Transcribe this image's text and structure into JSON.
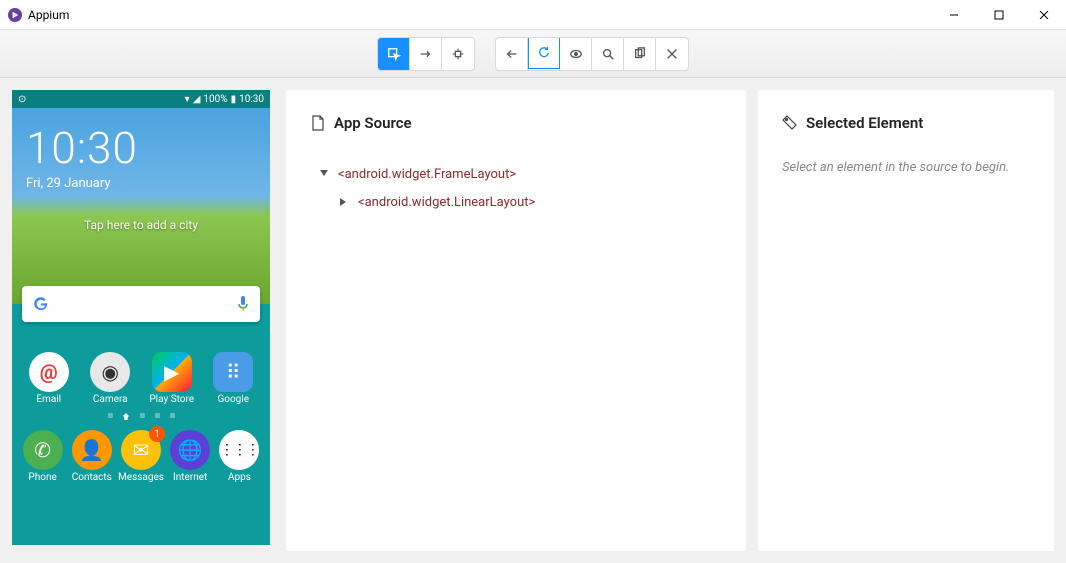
{
  "window": {
    "title": "Appium"
  },
  "toolbar": {
    "group1": {
      "select": "select",
      "swipe": "swipe",
      "tap": "tap-coords"
    },
    "group2": {
      "back": "back",
      "refresh": "refresh",
      "eye": "record",
      "search": "search",
      "copy": "copy-xml",
      "close": "quit"
    }
  },
  "source_panel": {
    "title": "App Source",
    "tree": [
      {
        "label": "<android.widget.FrameLayout>",
        "expanded": true
      },
      {
        "label": "<android.widget.LinearLayout>",
        "expanded": false
      }
    ]
  },
  "selected_panel": {
    "title": "Selected Element",
    "placeholder": "Select an element in the source to begin."
  },
  "phone": {
    "status": {
      "battery": "100%",
      "time": "10:30"
    },
    "clock": "10:30",
    "date": "Fri, 29 January",
    "hint": "Tap here to add a city",
    "apps_row1": [
      {
        "label": "Email",
        "color": "#fff",
        "glyph": "@",
        "glyphColor": "#e83b3b"
      },
      {
        "label": "Camera",
        "color": "#e8e8e8",
        "glyph": "◉",
        "glyphColor": "#333"
      },
      {
        "label": "Play Store",
        "color": "transparent",
        "glyph": "▶",
        "glyphColor": "#fff",
        "playTriangle": true
      },
      {
        "label": "Google",
        "color": "#4a9be8",
        "glyph": "⠿",
        "glyphColor": "#fff",
        "dots": true
      }
    ],
    "apps_row2": [
      {
        "label": "Phone",
        "color": "#4caf50",
        "glyph": "✆"
      },
      {
        "label": "Contacts",
        "color": "#ff9800",
        "glyph": "👤"
      },
      {
        "label": "Messages",
        "color": "#ffc107",
        "glyph": "✉",
        "badge": "1"
      },
      {
        "label": "Internet",
        "color": "#5c3fd6",
        "glyph": "🌐"
      },
      {
        "label": "Apps",
        "color": "#fff",
        "glyph": "⋮⋮⋮",
        "glyphColor": "#000",
        "gridDots": true
      }
    ]
  }
}
